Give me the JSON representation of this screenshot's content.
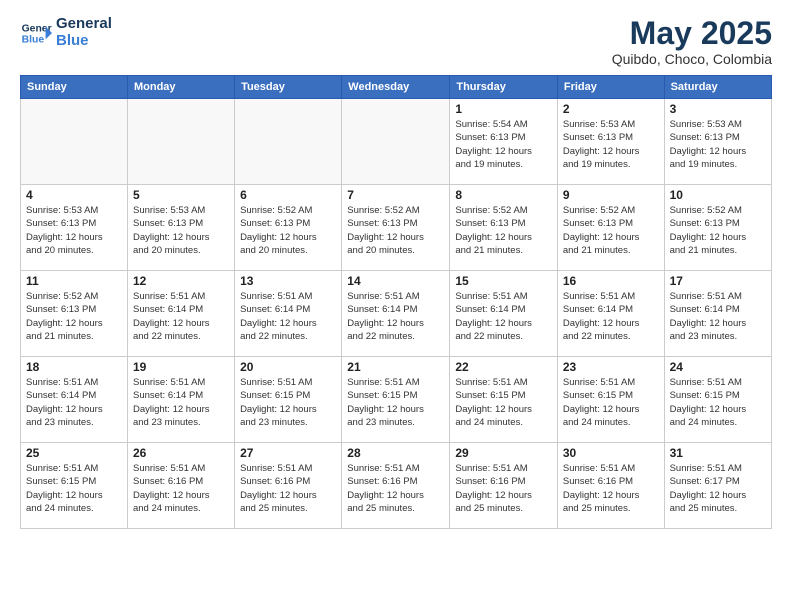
{
  "header": {
    "logo_general": "General",
    "logo_blue": "Blue",
    "title": "May 2025",
    "subtitle": "Quibdo, Choco, Colombia"
  },
  "weekdays": [
    "Sunday",
    "Monday",
    "Tuesday",
    "Wednesday",
    "Thursday",
    "Friday",
    "Saturday"
  ],
  "weeks": [
    [
      {
        "day": "",
        "info": ""
      },
      {
        "day": "",
        "info": ""
      },
      {
        "day": "",
        "info": ""
      },
      {
        "day": "",
        "info": ""
      },
      {
        "day": "1",
        "info": "Sunrise: 5:54 AM\nSunset: 6:13 PM\nDaylight: 12 hours\nand 19 minutes."
      },
      {
        "day": "2",
        "info": "Sunrise: 5:53 AM\nSunset: 6:13 PM\nDaylight: 12 hours\nand 19 minutes."
      },
      {
        "day": "3",
        "info": "Sunrise: 5:53 AM\nSunset: 6:13 PM\nDaylight: 12 hours\nand 19 minutes."
      }
    ],
    [
      {
        "day": "4",
        "info": "Sunrise: 5:53 AM\nSunset: 6:13 PM\nDaylight: 12 hours\nand 20 minutes."
      },
      {
        "day": "5",
        "info": "Sunrise: 5:53 AM\nSunset: 6:13 PM\nDaylight: 12 hours\nand 20 minutes."
      },
      {
        "day": "6",
        "info": "Sunrise: 5:52 AM\nSunset: 6:13 PM\nDaylight: 12 hours\nand 20 minutes."
      },
      {
        "day": "7",
        "info": "Sunrise: 5:52 AM\nSunset: 6:13 PM\nDaylight: 12 hours\nand 20 minutes."
      },
      {
        "day": "8",
        "info": "Sunrise: 5:52 AM\nSunset: 6:13 PM\nDaylight: 12 hours\nand 21 minutes."
      },
      {
        "day": "9",
        "info": "Sunrise: 5:52 AM\nSunset: 6:13 PM\nDaylight: 12 hours\nand 21 minutes."
      },
      {
        "day": "10",
        "info": "Sunrise: 5:52 AM\nSunset: 6:13 PM\nDaylight: 12 hours\nand 21 minutes."
      }
    ],
    [
      {
        "day": "11",
        "info": "Sunrise: 5:52 AM\nSunset: 6:13 PM\nDaylight: 12 hours\nand 21 minutes."
      },
      {
        "day": "12",
        "info": "Sunrise: 5:51 AM\nSunset: 6:14 PM\nDaylight: 12 hours\nand 22 minutes."
      },
      {
        "day": "13",
        "info": "Sunrise: 5:51 AM\nSunset: 6:14 PM\nDaylight: 12 hours\nand 22 minutes."
      },
      {
        "day": "14",
        "info": "Sunrise: 5:51 AM\nSunset: 6:14 PM\nDaylight: 12 hours\nand 22 minutes."
      },
      {
        "day": "15",
        "info": "Sunrise: 5:51 AM\nSunset: 6:14 PM\nDaylight: 12 hours\nand 22 minutes."
      },
      {
        "day": "16",
        "info": "Sunrise: 5:51 AM\nSunset: 6:14 PM\nDaylight: 12 hours\nand 22 minutes."
      },
      {
        "day": "17",
        "info": "Sunrise: 5:51 AM\nSunset: 6:14 PM\nDaylight: 12 hours\nand 23 minutes."
      }
    ],
    [
      {
        "day": "18",
        "info": "Sunrise: 5:51 AM\nSunset: 6:14 PM\nDaylight: 12 hours\nand 23 minutes."
      },
      {
        "day": "19",
        "info": "Sunrise: 5:51 AM\nSunset: 6:14 PM\nDaylight: 12 hours\nand 23 minutes."
      },
      {
        "day": "20",
        "info": "Sunrise: 5:51 AM\nSunset: 6:15 PM\nDaylight: 12 hours\nand 23 minutes."
      },
      {
        "day": "21",
        "info": "Sunrise: 5:51 AM\nSunset: 6:15 PM\nDaylight: 12 hours\nand 23 minutes."
      },
      {
        "day": "22",
        "info": "Sunrise: 5:51 AM\nSunset: 6:15 PM\nDaylight: 12 hours\nand 24 minutes."
      },
      {
        "day": "23",
        "info": "Sunrise: 5:51 AM\nSunset: 6:15 PM\nDaylight: 12 hours\nand 24 minutes."
      },
      {
        "day": "24",
        "info": "Sunrise: 5:51 AM\nSunset: 6:15 PM\nDaylight: 12 hours\nand 24 minutes."
      }
    ],
    [
      {
        "day": "25",
        "info": "Sunrise: 5:51 AM\nSunset: 6:15 PM\nDaylight: 12 hours\nand 24 minutes."
      },
      {
        "day": "26",
        "info": "Sunrise: 5:51 AM\nSunset: 6:16 PM\nDaylight: 12 hours\nand 24 minutes."
      },
      {
        "day": "27",
        "info": "Sunrise: 5:51 AM\nSunset: 6:16 PM\nDaylight: 12 hours\nand 25 minutes."
      },
      {
        "day": "28",
        "info": "Sunrise: 5:51 AM\nSunset: 6:16 PM\nDaylight: 12 hours\nand 25 minutes."
      },
      {
        "day": "29",
        "info": "Sunrise: 5:51 AM\nSunset: 6:16 PM\nDaylight: 12 hours\nand 25 minutes."
      },
      {
        "day": "30",
        "info": "Sunrise: 5:51 AM\nSunset: 6:16 PM\nDaylight: 12 hours\nand 25 minutes."
      },
      {
        "day": "31",
        "info": "Sunrise: 5:51 AM\nSunset: 6:17 PM\nDaylight: 12 hours\nand 25 minutes."
      }
    ]
  ]
}
